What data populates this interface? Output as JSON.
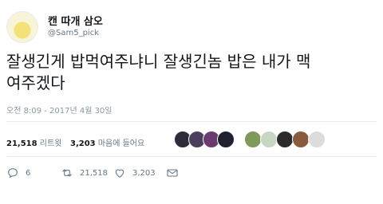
{
  "author": {
    "display_name": "캔 따개 삼오",
    "handle": "@Sam5_pick",
    "avatar_icon": "yellow-chick-avatar"
  },
  "tweet": {
    "text_line1": "잘생긴게 밥먹여주냐니 잘생긴놈 밥은 내가 맥",
    "text_line2": "여주겠다",
    "timestamp": "오전 8:09 - 2017년 4월 30일"
  },
  "stats": {
    "retweets_count": "21,518",
    "retweets_label": "리트윗",
    "likes_count": "3,203",
    "likes_label": "마음에 들어요",
    "liker_avatars": [
      {
        "icon": "liker-avatar-1",
        "color": "#2c2c3a"
      },
      {
        "icon": "liker-avatar-2",
        "color": "#4a3f5c"
      },
      {
        "icon": "liker-avatar-3",
        "color": "#6b3b6e"
      },
      {
        "icon": "liker-avatar-4",
        "color": "#1e2230"
      },
      {
        "icon": "liker-avatar-5",
        "color": "#7e9a5a"
      },
      {
        "icon": "liker-avatar-6",
        "color": "#c9d6c2"
      },
      {
        "icon": "liker-avatar-7",
        "color": "#2b2b2b"
      },
      {
        "icon": "liker-avatar-8",
        "color": "#8a5a3c"
      },
      {
        "icon": "liker-avatar-9",
        "color": "#dcdcdc"
      }
    ]
  },
  "actions": {
    "reply_count": "6",
    "retweet_count": "21,518",
    "like_count": "3,203"
  },
  "colors": {
    "primary_text": "#14171a",
    "secondary_text": "#657786",
    "divider": "#e6ecf0"
  }
}
